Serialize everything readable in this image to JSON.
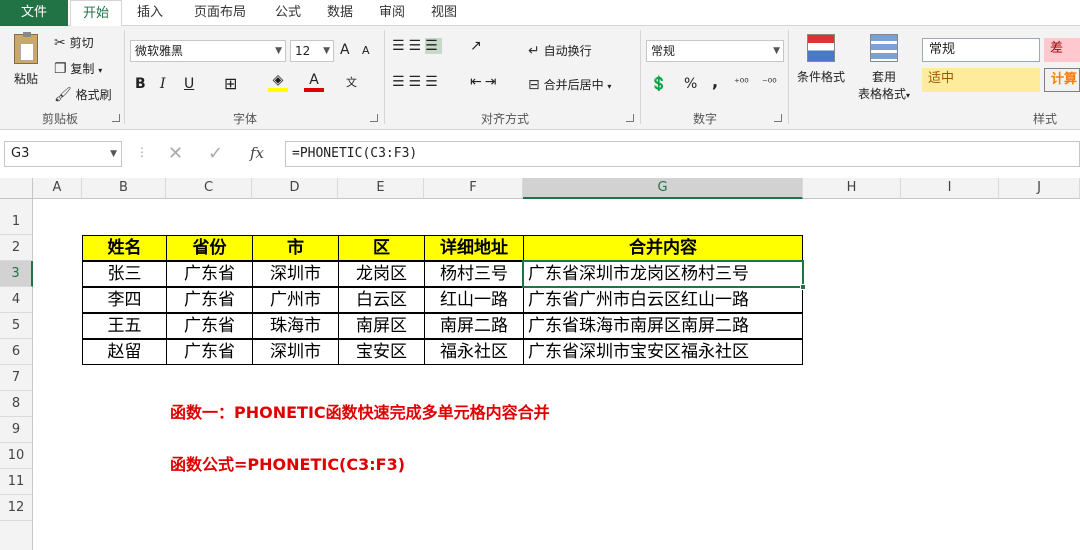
{
  "tabs": [
    "文件",
    "开始",
    "插入",
    "页面布局",
    "公式",
    "数据",
    "审阅",
    "视图"
  ],
  "clipboard": {
    "paste": "粘贴",
    "cut": "剪切",
    "copy": "复制",
    "format_painter": "格式刷",
    "label": "剪贴板"
  },
  "font": {
    "name": "微软雅黑",
    "size": "12",
    "label": "字体",
    "bold": "B",
    "italic": "I",
    "underline": "U",
    "grow": "A",
    "shrink": "A",
    "font_color_glyph": "A",
    "phonetic": "文"
  },
  "alignment": {
    "wrap": "自动换行",
    "merge": "合并后居中",
    "label": "对齐方式"
  },
  "number": {
    "format": "常规",
    "percent": "%",
    "comma": ",",
    "label": "数字"
  },
  "styles": {
    "conditional": "条件格式",
    "table_format_1": "套用",
    "table_format_2": "表格格式",
    "normal": "常规",
    "bad": "差",
    "neutral": "适中",
    "calc": "计算",
    "label": "样式"
  },
  "formula_bar": {
    "name_box": "G3",
    "fx": "fx",
    "formula": "=PHONETIC(C3:F3)"
  },
  "columns": [
    "A",
    "B",
    "C",
    "D",
    "E",
    "F",
    "G",
    "H",
    "I",
    "J"
  ],
  "rows": [
    "1",
    "2",
    "3",
    "4",
    "5",
    "6",
    "7",
    "8",
    "9",
    "10",
    "11",
    "12"
  ],
  "table": {
    "headers": [
      "姓名",
      "省份",
      "市",
      "区",
      "详细地址",
      "合并内容"
    ],
    "rows": [
      [
        "张三",
        "广东省",
        "深圳市",
        "龙岗区",
        "杨村三号",
        "广东省深圳市龙岗区杨村三号"
      ],
      [
        "李四",
        "广东省",
        "广州市",
        "白云区",
        "红山一路",
        "广东省广州市白云区红山一路"
      ],
      [
        "王五",
        "广东省",
        "珠海市",
        "南屏区",
        "南屏二路",
        "广东省珠海市南屏区南屏二路"
      ],
      [
        "赵留",
        "广东省",
        "深圳市",
        "宝安区",
        "福永社区",
        "广东省深圳市宝安区福永社区"
      ]
    ]
  },
  "notes": {
    "line1": "函数一：PHONETIC函数快速完成多单元格内容合并",
    "line2": "函数公式=PHONETIC(C3:F3)"
  },
  "colors": {
    "accent": "#217346",
    "header_fill": "#ffff00",
    "note": "#e00000",
    "bad_fill": "#ffc7ce",
    "neutral_fill": "#ffeb9c"
  }
}
